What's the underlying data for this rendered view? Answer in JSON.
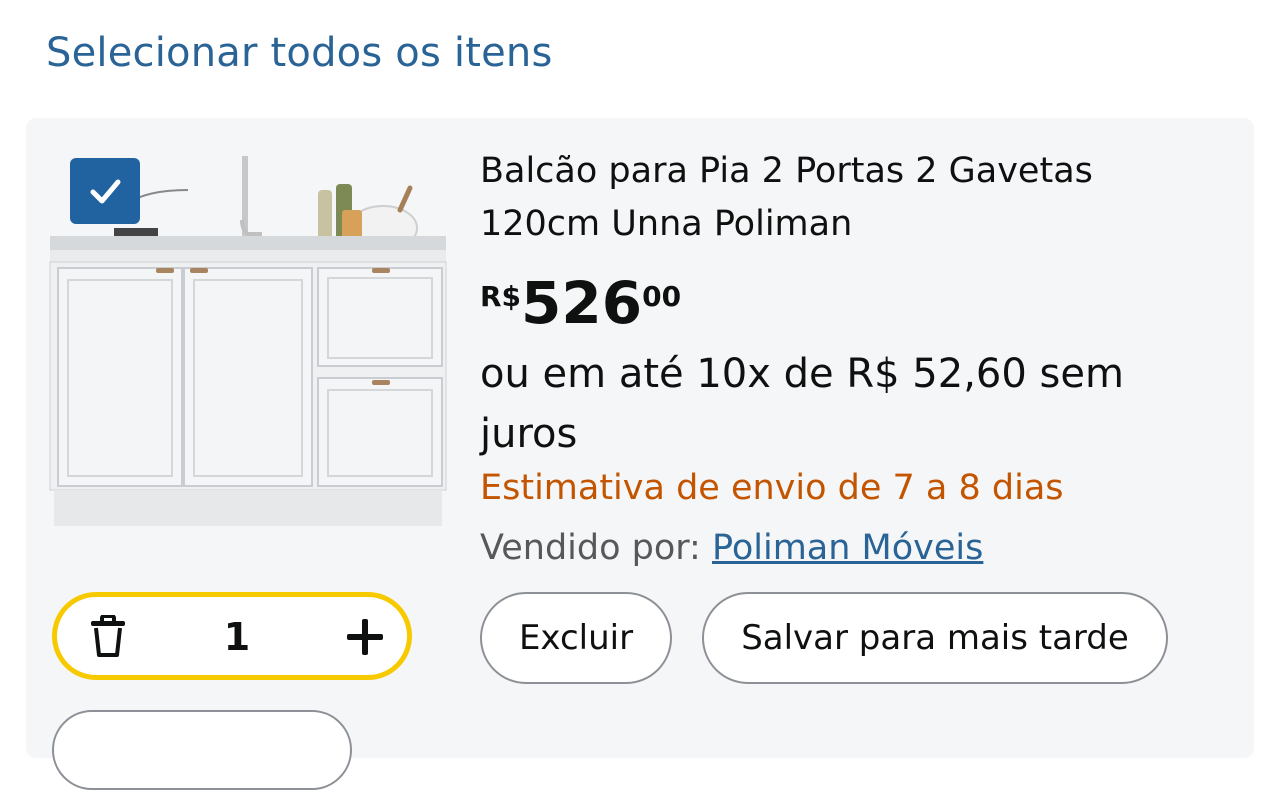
{
  "cart": {
    "select_all_label": "Selecionar todos os itens",
    "item": {
      "selected": true,
      "title": "Balcão para Pia 2 Portas 2 Gavetas 120cm Unna Poliman",
      "price": {
        "currency": "R$",
        "whole": "526",
        "cents": "00"
      },
      "installments": "ou em até 10x de R$ 52,60 sem juros",
      "shipping": "Estimativa de envio de 7 a 8 dias",
      "seller_label": "Vendido por:",
      "seller_name": "Poliman Móveis",
      "quantity": "1",
      "delete_label": "Excluir",
      "save_later_label": "Salvar para mais tarde"
    }
  },
  "colors": {
    "link": "#2a6496",
    "shipping": "#c45500",
    "checkbox": "#2162a1",
    "stepper_border": "#f7ca00"
  },
  "icons": [
    "checkmark-icon",
    "trash-icon",
    "plus-icon"
  ]
}
